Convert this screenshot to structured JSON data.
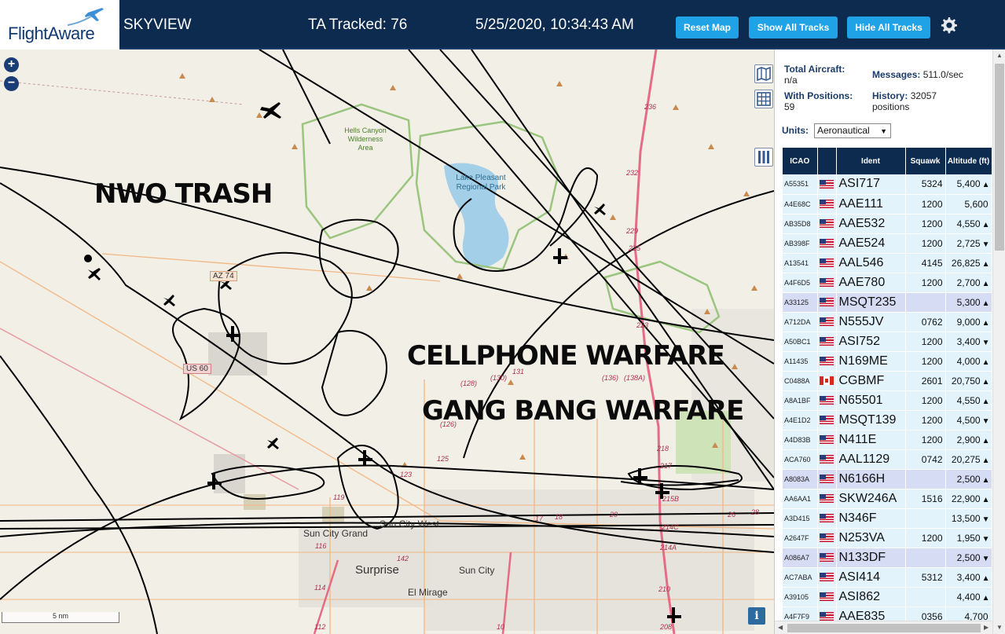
{
  "header": {
    "logo": "FlightAware",
    "app_name": "SKYVIEW",
    "ta_tracked": "TA Tracked: 76",
    "clock": "5/25/2020, 10:34:43 AM",
    "buttons": {
      "reset": "Reset Map",
      "show_all": "Show All Tracks",
      "hide_all": "Hide All Tracks"
    },
    "settings_icon": "gear-icon"
  },
  "map": {
    "overlay_texts": [
      "NWO TRASH",
      "CELLPHONE WARFARE",
      "GANG BANG WARFARE"
    ],
    "place_labels": {
      "hells_canyon": "Hells Canyon Wilderness Area",
      "lake_pleasant": "Lake Pleasant Regional Park",
      "sun_city_west": "Sun City West",
      "sun_city_grand": "Sun City Grand",
      "surprise": "Surprise",
      "sun_city": "Sun City",
      "el_mirage": "El Mirage"
    },
    "road_labels": {
      "az74": "AZ 74",
      "us60": "US 60",
      "r236": "236",
      "r232": "232",
      "r229": "229",
      "r225": "225",
      "r223": "223",
      "r218": "218",
      "r217": "217",
      "r215b": "215B",
      "r214c": "214C",
      "r214a": "214A",
      "r210": "210",
      "r208": "208",
      "r131": "131",
      "r130": "(130)",
      "r128": "(128)",
      "r126": "(126)",
      "r125": "125",
      "r123": "123",
      "r119": "119",
      "r116": "116",
      "r114": "114",
      "r112": "112",
      "r142": "142",
      "r17": "17",
      "r18": "18",
      "r20": "20",
      "r26": "26",
      "r28": "28",
      "r10": "10",
      "r136": "(136)",
      "r138": "(138A)"
    },
    "zoom_in": "+",
    "zoom_out": "−",
    "scale": "5 nm",
    "info": "i",
    "controls": [
      "map-icon",
      "grid-icon",
      "columns-icon"
    ]
  },
  "panel": {
    "total_aircraft_label": "Total Aircraft:",
    "total_aircraft_value": "n/a",
    "with_positions_label": "With Positions:",
    "with_positions_value": "59",
    "messages_label": "Messages:",
    "messages_value": "511.0/sec",
    "history_label": "History:",
    "history_value": "32057",
    "history_unit": "positions",
    "units_label": "Units:",
    "units_value": "Aeronautical",
    "columns": [
      "ICAO",
      "",
      "Ident",
      "Squawk",
      "Altitude (ft)"
    ],
    "rows": [
      {
        "icao": "A55351",
        "flag": "us",
        "ident": "ASI717",
        "squawk": "5324",
        "alt": "5,400",
        "trend": "▲",
        "sel": false
      },
      {
        "icao": "A4E68C",
        "flag": "us",
        "ident": "AAE111",
        "squawk": "1200",
        "alt": "5,600",
        "trend": "",
        "sel": false
      },
      {
        "icao": "AB35D8",
        "flag": "us",
        "ident": "AAE532",
        "squawk": "1200",
        "alt": "4,550",
        "trend": "▲",
        "sel": false
      },
      {
        "icao": "AB398F",
        "flag": "us",
        "ident": "AAE524",
        "squawk": "1200",
        "alt": "2,725",
        "trend": "▼",
        "sel": false
      },
      {
        "icao": "A13541",
        "flag": "us",
        "ident": "AAL546",
        "squawk": "4145",
        "alt": "26,825",
        "trend": "▲",
        "sel": false
      },
      {
        "icao": "A4F6D5",
        "flag": "us",
        "ident": "AAE780",
        "squawk": "1200",
        "alt": "2,700",
        "trend": "▲",
        "sel": false
      },
      {
        "icao": "A33125",
        "flag": "us",
        "ident": "MSQT235",
        "squawk": "",
        "alt": "5,300",
        "trend": "▲",
        "sel": true
      },
      {
        "icao": "A712DA",
        "flag": "us",
        "ident": "N555JV",
        "squawk": "0762",
        "alt": "9,000",
        "trend": "▲",
        "sel": false
      },
      {
        "icao": "A50BC1",
        "flag": "us",
        "ident": "ASI752",
        "squawk": "1200",
        "alt": "3,400",
        "trend": "▼",
        "sel": false
      },
      {
        "icao": "A11435",
        "flag": "us",
        "ident": "N169ME",
        "squawk": "1200",
        "alt": "4,000",
        "trend": "▲",
        "sel": false
      },
      {
        "icao": "C0488A",
        "flag": "ca",
        "ident": "CGBMF",
        "squawk": "2601",
        "alt": "20,750",
        "trend": "▲",
        "sel": false
      },
      {
        "icao": "A8A1BF",
        "flag": "us",
        "ident": "N65501",
        "squawk": "1200",
        "alt": "4,550",
        "trend": "▲",
        "sel": false
      },
      {
        "icao": "A4E1D2",
        "flag": "us",
        "ident": "MSQT139",
        "squawk": "1200",
        "alt": "4,500",
        "trend": "▼",
        "sel": false
      },
      {
        "icao": "A4D83B",
        "flag": "us",
        "ident": "N411E",
        "squawk": "1200",
        "alt": "2,900",
        "trend": "▲",
        "sel": false
      },
      {
        "icao": "ACA760",
        "flag": "us",
        "ident": "AAL1129",
        "squawk": "0742",
        "alt": "20,275",
        "trend": "▲",
        "sel": false
      },
      {
        "icao": "A8083A",
        "flag": "us",
        "ident": "N6166H",
        "squawk": "",
        "alt": "2,500",
        "trend": "▲",
        "sel": true
      },
      {
        "icao": "AA6AA1",
        "flag": "us",
        "ident": "SKW246A",
        "squawk": "1516",
        "alt": "22,900",
        "trend": "▲",
        "sel": false
      },
      {
        "icao": "A3D415",
        "flag": "us",
        "ident": "N346F",
        "squawk": "",
        "alt": "13,500",
        "trend": "▼",
        "sel": false
      },
      {
        "icao": "A2647F",
        "flag": "us",
        "ident": "N253VA",
        "squawk": "1200",
        "alt": "1,950",
        "trend": "▼",
        "sel": false
      },
      {
        "icao": "A086A7",
        "flag": "us",
        "ident": "N133DF",
        "squawk": "",
        "alt": "2,500",
        "trend": "▼",
        "sel": true
      },
      {
        "icao": "AC7ABA",
        "flag": "us",
        "ident": "ASI414",
        "squawk": "5312",
        "alt": "3,400",
        "trend": "▲",
        "sel": false
      },
      {
        "icao": "A39105",
        "flag": "us",
        "ident": "ASI862",
        "squawk": "",
        "alt": "4,400",
        "trend": "▲",
        "sel": false
      },
      {
        "icao": "A4F7F9",
        "flag": "us",
        "ident": "AAE835",
        "squawk": "0356",
        "alt": "4,700",
        "trend": "",
        "sel": false
      }
    ]
  }
}
